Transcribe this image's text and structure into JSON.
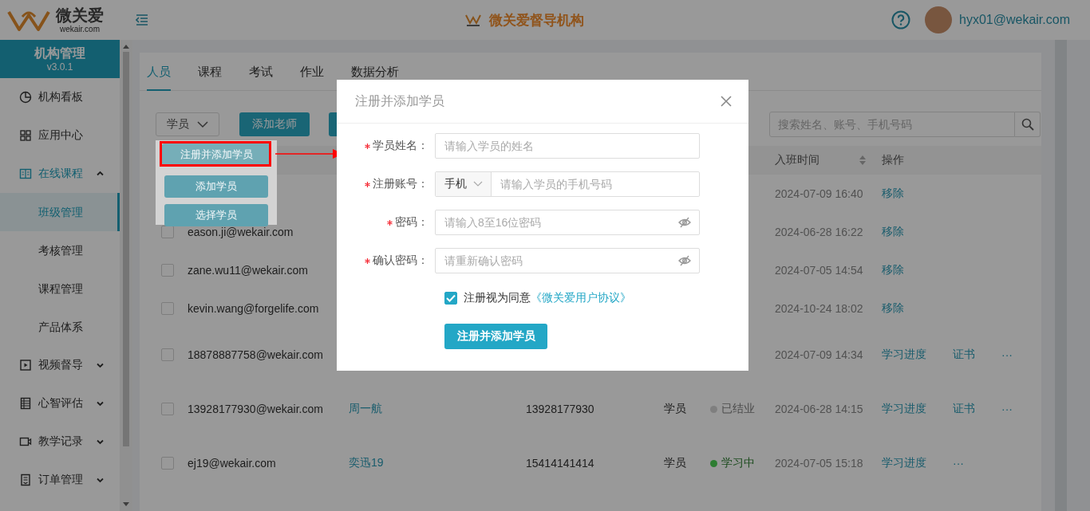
{
  "header": {
    "logo_text": "微关爱",
    "logo_subtext": "wekair.com",
    "brand_title": "微关爱督导机构",
    "user": "hyx01@wekair.com"
  },
  "sidebar": {
    "title": "机构管理",
    "version": "v3.0.1",
    "items": [
      {
        "label": "机构看板",
        "selected": false
      },
      {
        "label": "应用中心",
        "selected": false
      },
      {
        "label": "在线课程",
        "selected": false,
        "expanded": true,
        "children": [
          {
            "label": "班级管理",
            "selected": true
          },
          {
            "label": "考核管理",
            "selected": false
          },
          {
            "label": "课程管理",
            "selected": false
          },
          {
            "label": "产品体系",
            "selected": false
          }
        ]
      },
      {
        "label": "视频督导",
        "selected": false,
        "expanded": false
      },
      {
        "label": "心智评估",
        "selected": false,
        "expanded": false
      },
      {
        "label": "教学记录",
        "selected": false,
        "expanded": false
      },
      {
        "label": "订单管理",
        "selected": false,
        "expanded": false
      }
    ]
  },
  "tabs": [
    {
      "label": "人员",
      "selected": true
    },
    {
      "label": "课程",
      "selected": false
    },
    {
      "label": "考试",
      "selected": false
    },
    {
      "label": "作业",
      "selected": false
    },
    {
      "label": "数据分析",
      "selected": false
    }
  ],
  "toolbar": {
    "role_select": "学员",
    "add_teacher": "添加老师",
    "search_placeholder": "搜索姓名、账号、手机号码"
  },
  "role_menu": {
    "items": [
      {
        "label": "注册并添加学员",
        "highlighted": true
      },
      {
        "label": "添加学员",
        "highlighted": false
      },
      {
        "label": "选择学员",
        "highlighted": false
      }
    ]
  },
  "table": {
    "columns": [
      {
        "label": "入班时间",
        "sortable": true
      },
      {
        "label": "操作"
      }
    ],
    "rows": [
      {
        "joined": "2024-07-09 16:40",
        "actions": [
          "移除"
        ]
      },
      {
        "checked": false,
        "account": "eason.ji@wekair.com",
        "joined": "2024-06-28 16:22",
        "actions": [
          "移除"
        ]
      },
      {
        "checked": false,
        "account": "zane.wu11@wekair.com",
        "joined": "2024-07-05 14:54",
        "actions": [
          "移除"
        ]
      },
      {
        "checked": false,
        "account": "kevin.wang@forgelife.com",
        "joined": "2024-10-24 18:02",
        "actions": [
          "移除"
        ]
      },
      {
        "checked": false,
        "account": "18878887758@wekair.com",
        "joined": "2024-07-09 14:34",
        "actions": [
          "学习进度",
          "证书",
          "···"
        ]
      },
      {
        "checked": false,
        "account": "13928177930@wekair.com",
        "name": "周一航",
        "phone": "13928177930",
        "role": "学员",
        "status": {
          "text": "已结业",
          "color": "#7f7f7f"
        },
        "joined": "2024-06-28 14:15",
        "actions": [
          "学习进度",
          "证书",
          "···"
        ]
      },
      {
        "checked": false,
        "account": "ej19@wekair.com",
        "name": "奕迅19",
        "phone": "15414141414",
        "role": "学员",
        "status": {
          "text": "学习中",
          "color": "#2e7d32"
        },
        "joined": "2024-07-05 15:18",
        "actions": [
          "学习进度",
          "···"
        ]
      }
    ]
  },
  "dialog": {
    "title": "注册并添加学员",
    "fields": [
      {
        "kind": "text",
        "label": "学员姓名：",
        "required": true,
        "placeholder": "请输入学员的姓名"
      },
      {
        "kind": "account",
        "label": "注册账号：",
        "required": true,
        "prefix": "手机",
        "placeholder": "请输入学员的手机号码"
      },
      {
        "kind": "password",
        "label": "密码：",
        "required": true,
        "placeholder": "请输入8至16位密码"
      },
      {
        "kind": "password",
        "label": "确认密码：",
        "required": true,
        "placeholder": "请重新确认密码"
      }
    ],
    "agree": {
      "checked": true,
      "text": "注册视为同意",
      "link": "《微关爱用户协议》"
    },
    "submit": "注册并添加学员"
  }
}
